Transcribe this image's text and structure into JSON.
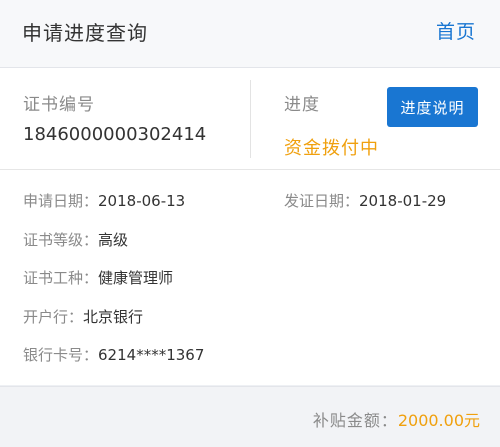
{
  "header": {
    "title": "申请进度查询",
    "home_link": "首页"
  },
  "summary": {
    "cert_label": "证书编号",
    "cert_number": "1846000000302414",
    "progress_label": "进度",
    "progress_button": "进度说明",
    "progress_status": "资金拨付中"
  },
  "details": {
    "apply_date_label": "申请日期：",
    "apply_date": "2018-06-13",
    "issue_date_label": "发证日期：",
    "issue_date": "2018-01-29",
    "level_label": "证书等级：",
    "level": "高级",
    "type_label": "证书工种：",
    "type": "健康管理师",
    "bank_label": "开户行：",
    "bank": "北京银行",
    "card_label": "银行卡号：",
    "card": "6214****1367"
  },
  "footer": {
    "subsidy_label": "补贴金额：",
    "subsidy_amount": "2000.00元"
  },
  "colors": {
    "accent": "#1976d2",
    "status": "#f0a00e",
    "background": "#eef0f4"
  }
}
